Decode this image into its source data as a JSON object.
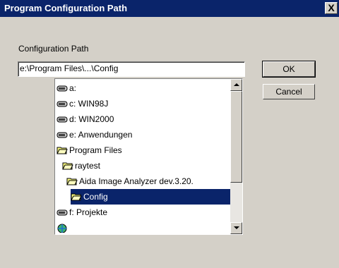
{
  "window": {
    "title": "Program Configuration Path",
    "close_glyph": "X"
  },
  "form": {
    "label": "Configuration Path",
    "path_value": "e:\\Program Files\\...\\Config"
  },
  "buttons": {
    "ok": "OK",
    "cancel": "Cancel"
  },
  "tree": {
    "items": [
      {
        "label": "a:",
        "icon": "drive-icon"
      },
      {
        "label": "c: WIN98J",
        "icon": "drive-icon"
      },
      {
        "label": "d: WIN2000",
        "icon": "drive-icon"
      },
      {
        "label": "e: Anwendungen",
        "icon": "drive-icon"
      },
      {
        "label": "Program Files",
        "icon": "open-folder-icon"
      },
      {
        "label": "raytest",
        "icon": "open-folder-icon"
      },
      {
        "label": "Aida Image Analyzer dev.3.20.",
        "icon": "open-folder-icon"
      },
      {
        "label": "Config",
        "icon": "open-folder-icon",
        "selected": true
      },
      {
        "label": "f: Projekte",
        "icon": "drive-icon"
      },
      {
        "label": "",
        "icon": "network-icon"
      }
    ]
  },
  "colors": {
    "titlebar": "#0a246a",
    "selection": "#0a246a",
    "face": "#d4d0c8"
  }
}
